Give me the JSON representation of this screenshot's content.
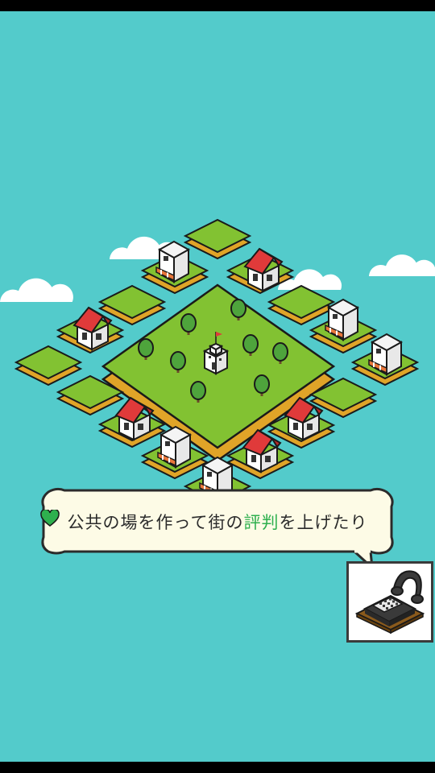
{
  "hint": {
    "text_before": "公共の場を作って街の",
    "highlight": "評判",
    "text_after": "を上げたり",
    "highlight_icon": "heart-icon"
  },
  "icons": {
    "phone_button": "telephone-icon"
  },
  "colors": {
    "sky": "#53cbcb",
    "grass": "#82c232",
    "tile_edge": "#e0a428",
    "highlight": "#2eb04e"
  }
}
